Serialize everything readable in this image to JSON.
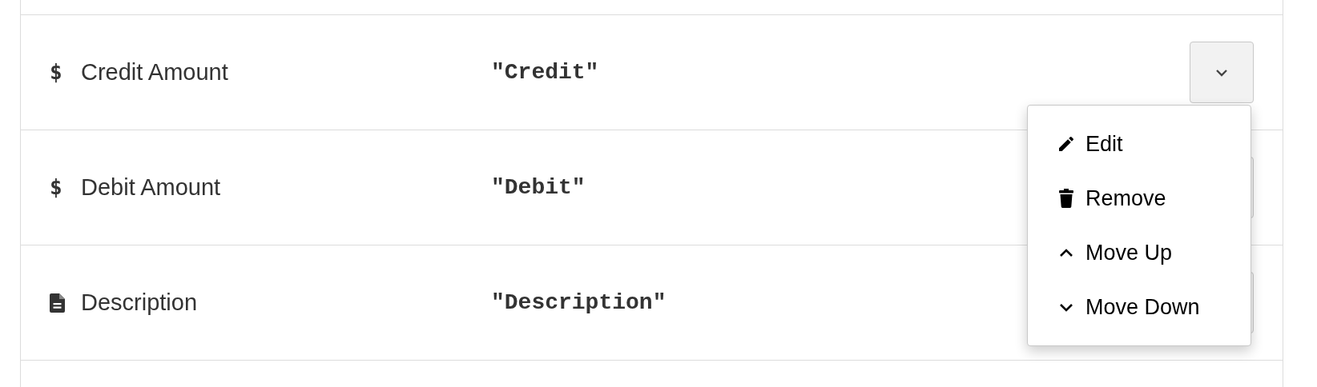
{
  "fields": [
    {
      "icon": "$",
      "kind": "text_icon",
      "label": "Credit Amount",
      "value": "\"Credit\"",
      "menu_open": true
    },
    {
      "icon": "$",
      "kind": "text_icon",
      "label": "Debit Amount",
      "value": "\"Debit\"",
      "menu_open": false
    },
    {
      "kind": "document",
      "label": "Description",
      "value": "\"Description\"",
      "menu_open": false
    }
  ],
  "menu": {
    "items": [
      {
        "kind": "edit",
        "label": "Edit"
      },
      {
        "kind": "remove",
        "label": "Remove"
      },
      {
        "kind": "up",
        "label": "Move Up"
      },
      {
        "kind": "down",
        "label": "Move Down"
      }
    ]
  }
}
